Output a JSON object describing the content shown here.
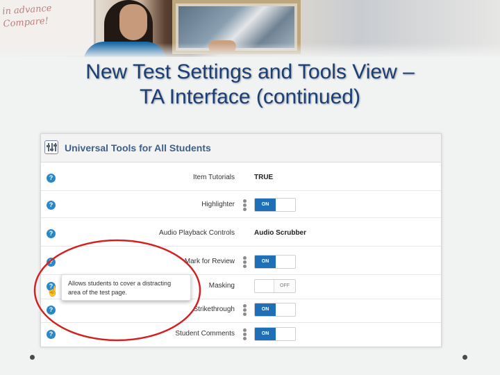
{
  "slide": {
    "title_line1": "New Test Settings and Tools View –",
    "title_line2": "TA Interface (continued)",
    "photo_board_text": [
      "in advance",
      "Compare!"
    ]
  },
  "panel": {
    "header_icon": "sliders-icon",
    "title": "Universal Tools for All Students",
    "rows": [
      {
        "label": "Item Tutorials",
        "kind": "text",
        "value": "TRUE"
      },
      {
        "label": "Highlighter",
        "kind": "toggle",
        "state_label": "ON"
      },
      {
        "label": "Audio Playback Controls",
        "kind": "text",
        "value": "Audio Scrubber"
      },
      {
        "label": "Mark for Review",
        "kind": "toggle",
        "state_label": "ON"
      },
      {
        "label": "Masking",
        "kind": "toggle",
        "state_label": "OFF"
      },
      {
        "label": "Strikethrough",
        "kind": "toggle",
        "state_label": "ON"
      },
      {
        "label": "Student Comments",
        "kind": "toggle",
        "state_label": "ON"
      }
    ],
    "help_glyph": "?",
    "tooltip_text": "Allows students to cover a distracting area of the test page.",
    "tooltip_line1": "Allows students to cover a distracting",
    "tooltip_line2": "area of the test page."
  },
  "colors": {
    "title": "#1b3f74",
    "panel_title": "#3d5f88",
    "toggle_on": "#1f6fb8",
    "help_icon": "#2b88c8",
    "highlight_ellipse": "#d42020"
  }
}
